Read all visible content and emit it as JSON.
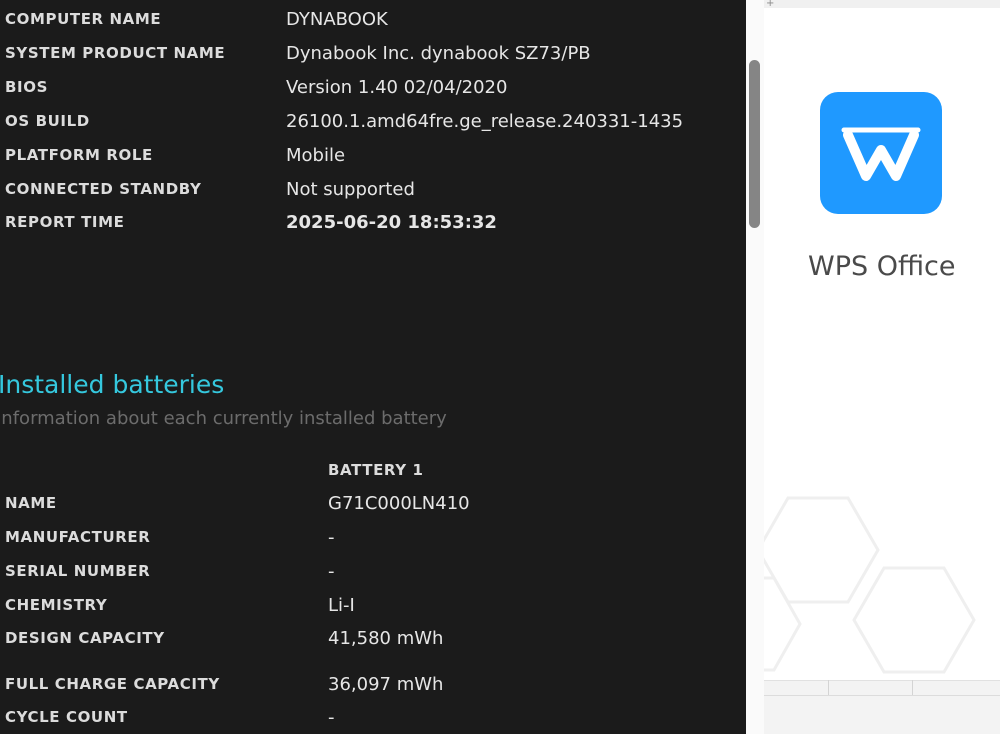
{
  "system_info": [
    {
      "key": "COMPUTER NAME",
      "value": "DYNABOOK"
    },
    {
      "key": "SYSTEM PRODUCT NAME",
      "value": "Dynabook Inc. dynabook SZ73/PB"
    },
    {
      "key": "BIOS",
      "value": "Version 1.40 02/04/2020"
    },
    {
      "key": "OS BUILD",
      "value": "26100.1.amd64fre.ge_release.240331-1435"
    },
    {
      "key": "PLATFORM ROLE",
      "value": "Mobile"
    },
    {
      "key": "CONNECTED STANDBY",
      "value": "Not supported"
    },
    {
      "key": "REPORT TIME",
      "value": "2025-06-20  18:53:32"
    }
  ],
  "installed_batteries": {
    "title": "Installed batteries",
    "subtitle": "Information about each currently installed battery",
    "column_header": "BATTERY 1",
    "rows": [
      {
        "key": "NAME",
        "value": "G71C000LN410"
      },
      {
        "key": "MANUFACTURER",
        "value": "-"
      },
      {
        "key": "SERIAL NUMBER",
        "value": "-"
      },
      {
        "key": "CHEMISTRY",
        "value": "Li-I"
      },
      {
        "key": "DESIGN CAPACITY",
        "value": "41,580 mWh"
      },
      {
        "key": "FULL CHARGE CAPACITY",
        "value": "36,097 mWh"
      },
      {
        "key": "CYCLE COUNT",
        "value": "-"
      }
    ]
  },
  "splash": {
    "app_name": "WPS Office",
    "icon": "wps-office-logo-icon",
    "accent": "#1f99ff"
  },
  "colors": {
    "background": "#1b1b1b",
    "section_title": "#35c8de"
  }
}
